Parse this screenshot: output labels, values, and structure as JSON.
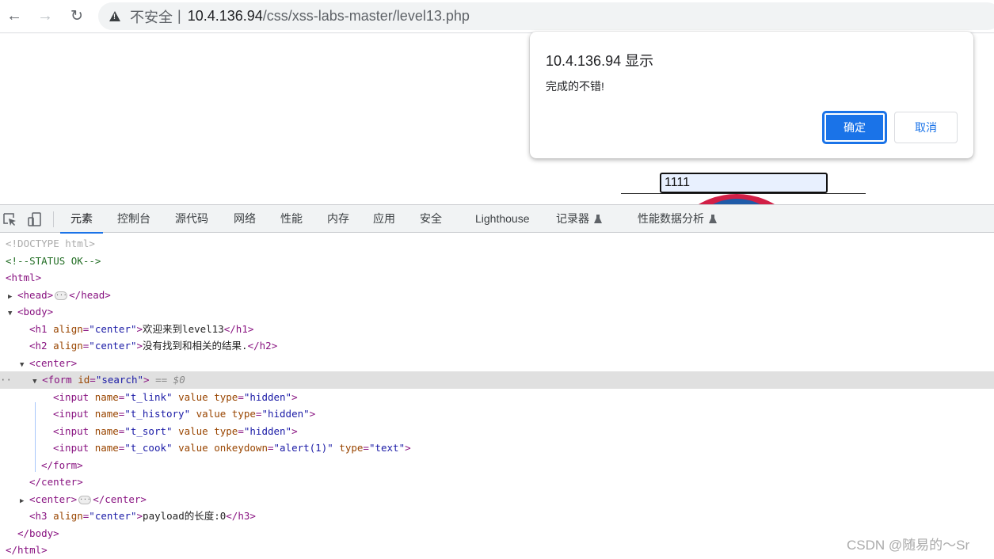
{
  "browser": {
    "insecure_label": "不安全",
    "url_host": "10.4.136.94",
    "url_path": "/css/xss-labs-master/level13.php",
    "icons": [
      "back-arrow-icon",
      "forward-arrow-icon",
      "reload-icon",
      "warning-icon"
    ]
  },
  "page": {
    "input_value": "1111"
  },
  "dialog": {
    "title": "10.4.136.94 显示",
    "message": "完成的不错!",
    "ok_label": "确定",
    "cancel_label": "取消",
    "accent": "#1a73e8"
  },
  "devtools": {
    "tabs": [
      {
        "label": "元素",
        "active": true
      },
      {
        "label": "控制台"
      },
      {
        "label": "源代码"
      },
      {
        "label": "网络"
      },
      {
        "label": "性能"
      },
      {
        "label": "内存"
      },
      {
        "label": "应用"
      },
      {
        "label": "安全"
      },
      {
        "label": "Lighthouse"
      },
      {
        "label": "记录器",
        "experimental": true
      },
      {
        "label": "性能数据分析",
        "experimental": true
      }
    ],
    "dom": {
      "doctype": "<!DOCTYPE html>",
      "comment": "<!--STATUS OK-->",
      "html_open": "<html>",
      "head_open": "<head>",
      "head_close": "</head>",
      "body_open": "<body>",
      "h1": {
        "tag": "h1",
        "attr": "align",
        "val": "\"center\"",
        "text": "欢迎来到level13"
      },
      "h2": {
        "tag": "h2",
        "attr": "align",
        "val": "\"center\"",
        "text": "没有找到和相关的结果."
      },
      "center_open": "<center>",
      "form": {
        "id_attr": "id",
        "id_val": "\"search\"",
        "marker": "== $0"
      },
      "inputs": [
        {
          "name": "\"t_link\"",
          "extra": "",
          "extra_val": "",
          "type": "\"hidden\""
        },
        {
          "name": "\"t_history\"",
          "extra": "",
          "extra_val": "",
          "type": "\"hidden\""
        },
        {
          "name": "\"t_sort\"",
          "extra": "",
          "extra_val": "",
          "type": "\"hidden\""
        },
        {
          "name": "\"t_cook\"",
          "extra": "onkeydown",
          "extra_val": "\"alert(1)\"",
          "type": "\"text\""
        }
      ],
      "form_close": "</form>",
      "center_close": "</center>",
      "center2_open": "<center>",
      "center2_close": "</center>",
      "h3": {
        "tag": "h3",
        "attr": "align",
        "val": "\"center\"",
        "text": "payload的长度:0"
      },
      "body_close": "</body>",
      "html_close": "</html>"
    }
  },
  "watermark": "CSDN @随易的～Sr"
}
